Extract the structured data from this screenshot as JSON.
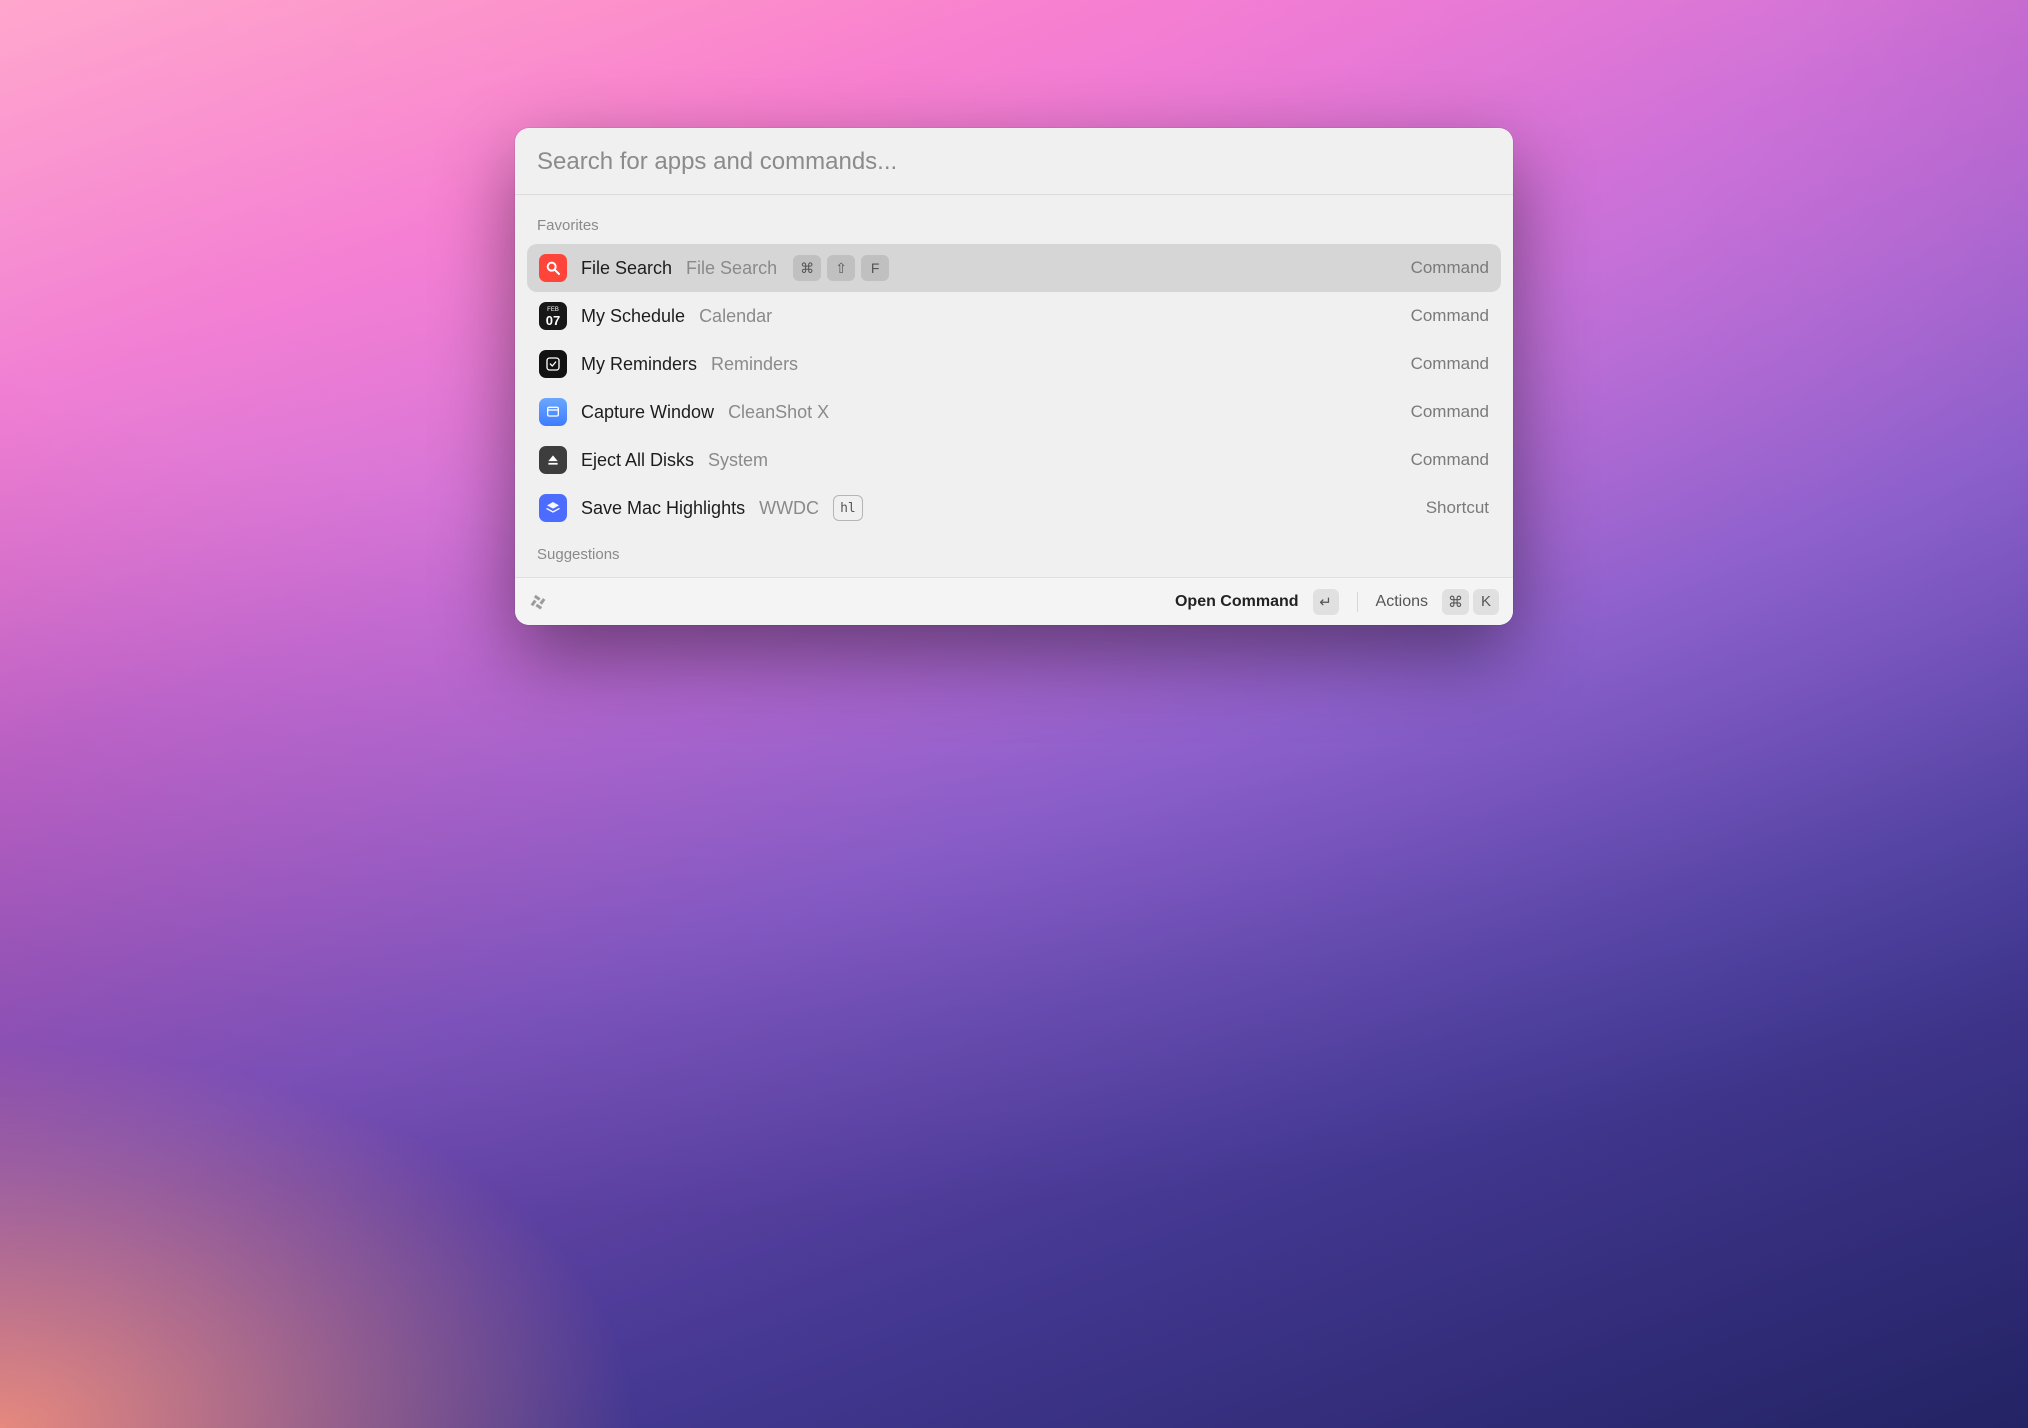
{
  "search": {
    "placeholder": "Search for apps and commands..."
  },
  "sections": {
    "favorites_label": "Favorites",
    "suggestions_label": "Suggestions"
  },
  "items": [
    {
      "title": "File Search",
      "subtitle": "File Search",
      "type": "Command",
      "hotkey": [
        "⌘",
        "⇧",
        "F"
      ],
      "icon": "search",
      "selected": true
    },
    {
      "title": "My Schedule",
      "subtitle": "Calendar",
      "type": "Command",
      "icon": "calendar",
      "calendar": {
        "month": "FEB",
        "day": "07"
      }
    },
    {
      "title": "My Reminders",
      "subtitle": "Reminders",
      "type": "Command",
      "icon": "reminders"
    },
    {
      "title": "Capture Window",
      "subtitle": "CleanShot X",
      "type": "Command",
      "icon": "capture"
    },
    {
      "title": "Eject All Disks",
      "subtitle": "System",
      "type": "Command",
      "icon": "eject"
    },
    {
      "title": "Save Mac Highlights",
      "subtitle": "WWDC",
      "type": "Shortcut",
      "icon": "wwdc",
      "badge": "hl"
    }
  ],
  "footer": {
    "open_label": "Open Command",
    "open_key": "↵",
    "actions_label": "Actions",
    "actions_keys": [
      "⌘",
      "K"
    ]
  }
}
